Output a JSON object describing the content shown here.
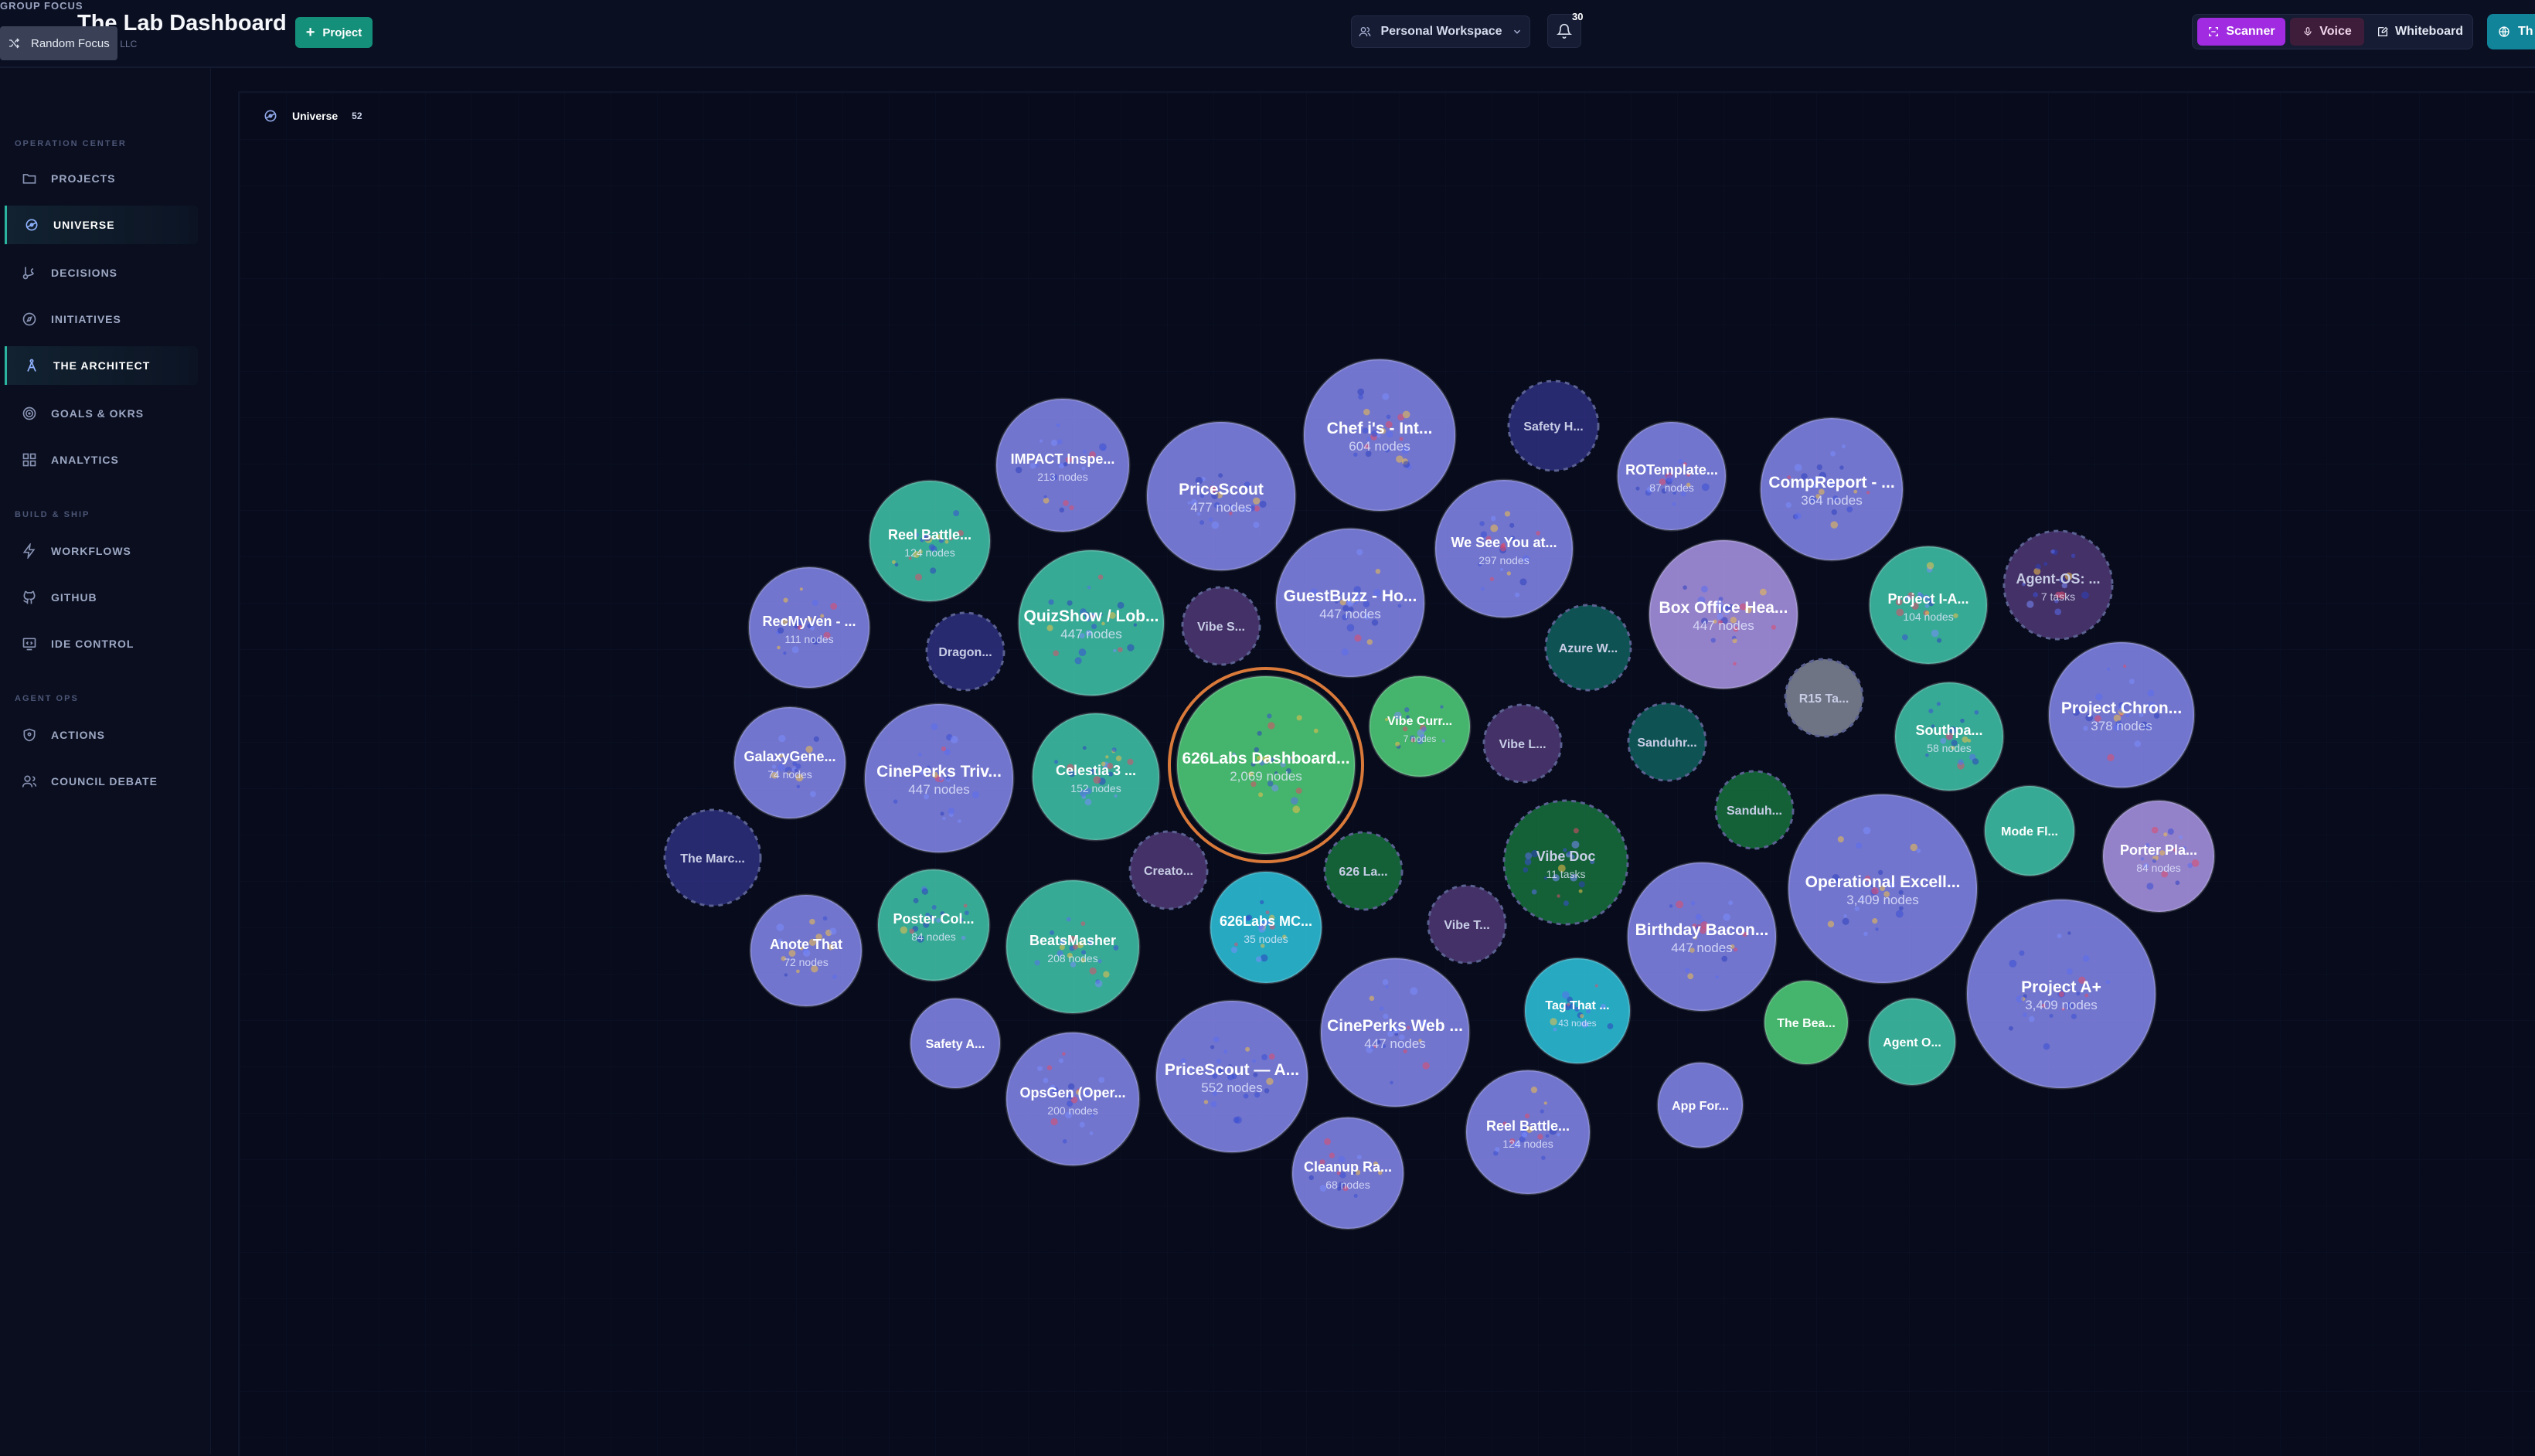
{
  "header": {
    "group_focus": "GROUP FOCUS",
    "random_focus": "Random Focus",
    "title": "The Lab Dashboard",
    "subtitle": "s LLC",
    "add_project": "Project",
    "workspace": "Personal Workspace",
    "notifications": "30",
    "tools": {
      "scanner": "Scanner",
      "voice": "Voice",
      "whiteboard": "Whiteboard",
      "extra": "Th"
    }
  },
  "sidebar": {
    "operation_center": "OPERATION CENTER",
    "build_ship": "BUILD & SHIP",
    "agent_ops": "AGENT OPS",
    "items": [
      {
        "label": "PROJECTS"
      },
      {
        "label": "UNIVERSE"
      },
      {
        "label": "DECISIONS"
      },
      {
        "label": "INITIATIVES"
      },
      {
        "label": "THE ARCHITECT"
      },
      {
        "label": "GOALS & OKRS"
      },
      {
        "label": "ANALYTICS"
      },
      {
        "label": "WORKFLOWS"
      },
      {
        "label": "GITHUB"
      },
      {
        "label": "IDE CONTROL"
      },
      {
        "label": "ACTIONS"
      },
      {
        "label": "COUNCIL DEBATE"
      }
    ]
  },
  "main": {
    "breadcrumb": "Universe",
    "count": "52"
  },
  "colors": {
    "indigo": "#8284e6",
    "teal": "#3fc0a6",
    "green": "#4fcc78",
    "cyan": "#2cc0d8",
    "violet": "#a793e2",
    "navy": "#2c2e7a",
    "darkteal": "#0f5a5a",
    "darkgreen": "#166a3c",
    "gray": "#7a8090",
    "plum": "#4a3570",
    "accent_scanner": "#a02be0",
    "accent_project": "#14907a"
  },
  "bubbles": [
    {
      "label": "IMPACT Inspe...",
      "sub": "213 nodes",
      "color": "indigo"
    },
    {
      "label": "PriceScout",
      "sub": "477 nodes",
      "color": "indigo"
    },
    {
      "label": "Chef i's - Int...",
      "sub": "604 nodes",
      "color": "indigo"
    },
    {
      "label": "Safety H...",
      "sub": "",
      "color": "navy"
    },
    {
      "label": "ROTemplate...",
      "sub": "87 nodes",
      "color": "indigo"
    },
    {
      "label": "CompReport - ...",
      "sub": "364 nodes",
      "color": "indigo"
    },
    {
      "label": "Reel Battle...",
      "sub": "124 nodes",
      "color": "teal"
    },
    {
      "label": "We See You at...",
      "sub": "297 nodes",
      "color": "indigo"
    },
    {
      "label": "RecMyVen - ...",
      "sub": "111 nodes",
      "color": "indigo"
    },
    {
      "label": "Dragon...",
      "sub": "",
      "color": "navy"
    },
    {
      "label": "QuizShow / Lob...",
      "sub": "447 nodes",
      "color": "teal"
    },
    {
      "label": "Vibe S...",
      "sub": "",
      "color": "plum"
    },
    {
      "label": "GuestBuzz - Ho...",
      "sub": "447 nodes",
      "color": "indigo"
    },
    {
      "label": "Azure W...",
      "sub": "",
      "color": "darkteal"
    },
    {
      "label": "Box Office Hea...",
      "sub": "447 nodes",
      "color": "violet"
    },
    {
      "label": "Project I-A...",
      "sub": "104 nodes",
      "color": "teal"
    },
    {
      "label": "Agent-OS: ...",
      "sub": "7 tasks",
      "color": "plum"
    },
    {
      "label": "R15 Ta...",
      "sub": "",
      "color": "gray"
    },
    {
      "label": "GalaxyGene...",
      "sub": "74 nodes",
      "color": "indigo"
    },
    {
      "label": "CinePerks Triv...",
      "sub": "447 nodes",
      "color": "indigo"
    },
    {
      "label": "Celestia 3 ...",
      "sub": "152 nodes",
      "color": "teal"
    },
    {
      "label": "626Labs Dashboard...",
      "sub": "2,069 nodes",
      "color": "green"
    },
    {
      "label": "Vibe Curr...",
      "sub": "7 nodes",
      "color": "green"
    },
    {
      "label": "Vibe L...",
      "sub": "",
      "color": "plum"
    },
    {
      "label": "Sanduhr...",
      "sub": "",
      "color": "darkteal"
    },
    {
      "label": "Southpa...",
      "sub": "58 nodes",
      "color": "teal"
    },
    {
      "label": "Project Chron...",
      "sub": "378 nodes",
      "color": "indigo"
    },
    {
      "label": "The Marc...",
      "sub": "",
      "color": "navy"
    },
    {
      "label": "Sanduh...",
      "sub": "",
      "color": "darkgreen"
    },
    {
      "label": "Mode Fl...",
      "sub": "",
      "color": "teal"
    },
    {
      "label": "Porter Pla...",
      "sub": "84 nodes",
      "color": "violet"
    },
    {
      "label": "Creato...",
      "sub": "",
      "color": "plum"
    },
    {
      "label": "626 La...",
      "sub": "",
      "color": "darkgreen"
    },
    {
      "label": "Vibe Doc",
      "sub": "11 tasks",
      "color": "darkgreen"
    },
    {
      "label": "Operational Excell...",
      "sub": "3,409 nodes",
      "color": "indigo"
    },
    {
      "label": "Poster Col...",
      "sub": "84 nodes",
      "color": "teal"
    },
    {
      "label": "Anote That",
      "sub": "72 nodes",
      "color": "indigo"
    },
    {
      "label": "BeatsMasher",
      "sub": "208 nodes",
      "color": "teal"
    },
    {
      "label": "626Labs MC...",
      "sub": "35 nodes",
      "color": "cyan"
    },
    {
      "label": "Vibe T...",
      "sub": "",
      "color": "plum"
    },
    {
      "label": "Birthday Bacon...",
      "sub": "447 nodes",
      "color": "indigo"
    },
    {
      "label": "Project A+",
      "sub": "3,409 nodes",
      "color": "indigo"
    },
    {
      "label": "Safety A...",
      "sub": "",
      "color": "indigo"
    },
    {
      "label": "Tag That ...",
      "sub": "43 nodes",
      "color": "cyan"
    },
    {
      "label": "The Bea...",
      "sub": "",
      "color": "green"
    },
    {
      "label": "Agent O...",
      "sub": "",
      "color": "teal"
    },
    {
      "label": "CinePerks Web ...",
      "sub": "447 nodes",
      "color": "indigo"
    },
    {
      "label": "PriceScout — A...",
      "sub": "552 nodes",
      "color": "indigo"
    },
    {
      "label": "OpsGen (Oper...",
      "sub": "200 nodes",
      "color": "indigo"
    },
    {
      "label": "App For...",
      "sub": "",
      "color": "indigo"
    },
    {
      "label": "Reel Battle...",
      "sub": "124 nodes",
      "color": "indigo"
    },
    {
      "label": "Cleanup Ra...",
      "sub": "68 nodes",
      "color": "indigo"
    }
  ]
}
